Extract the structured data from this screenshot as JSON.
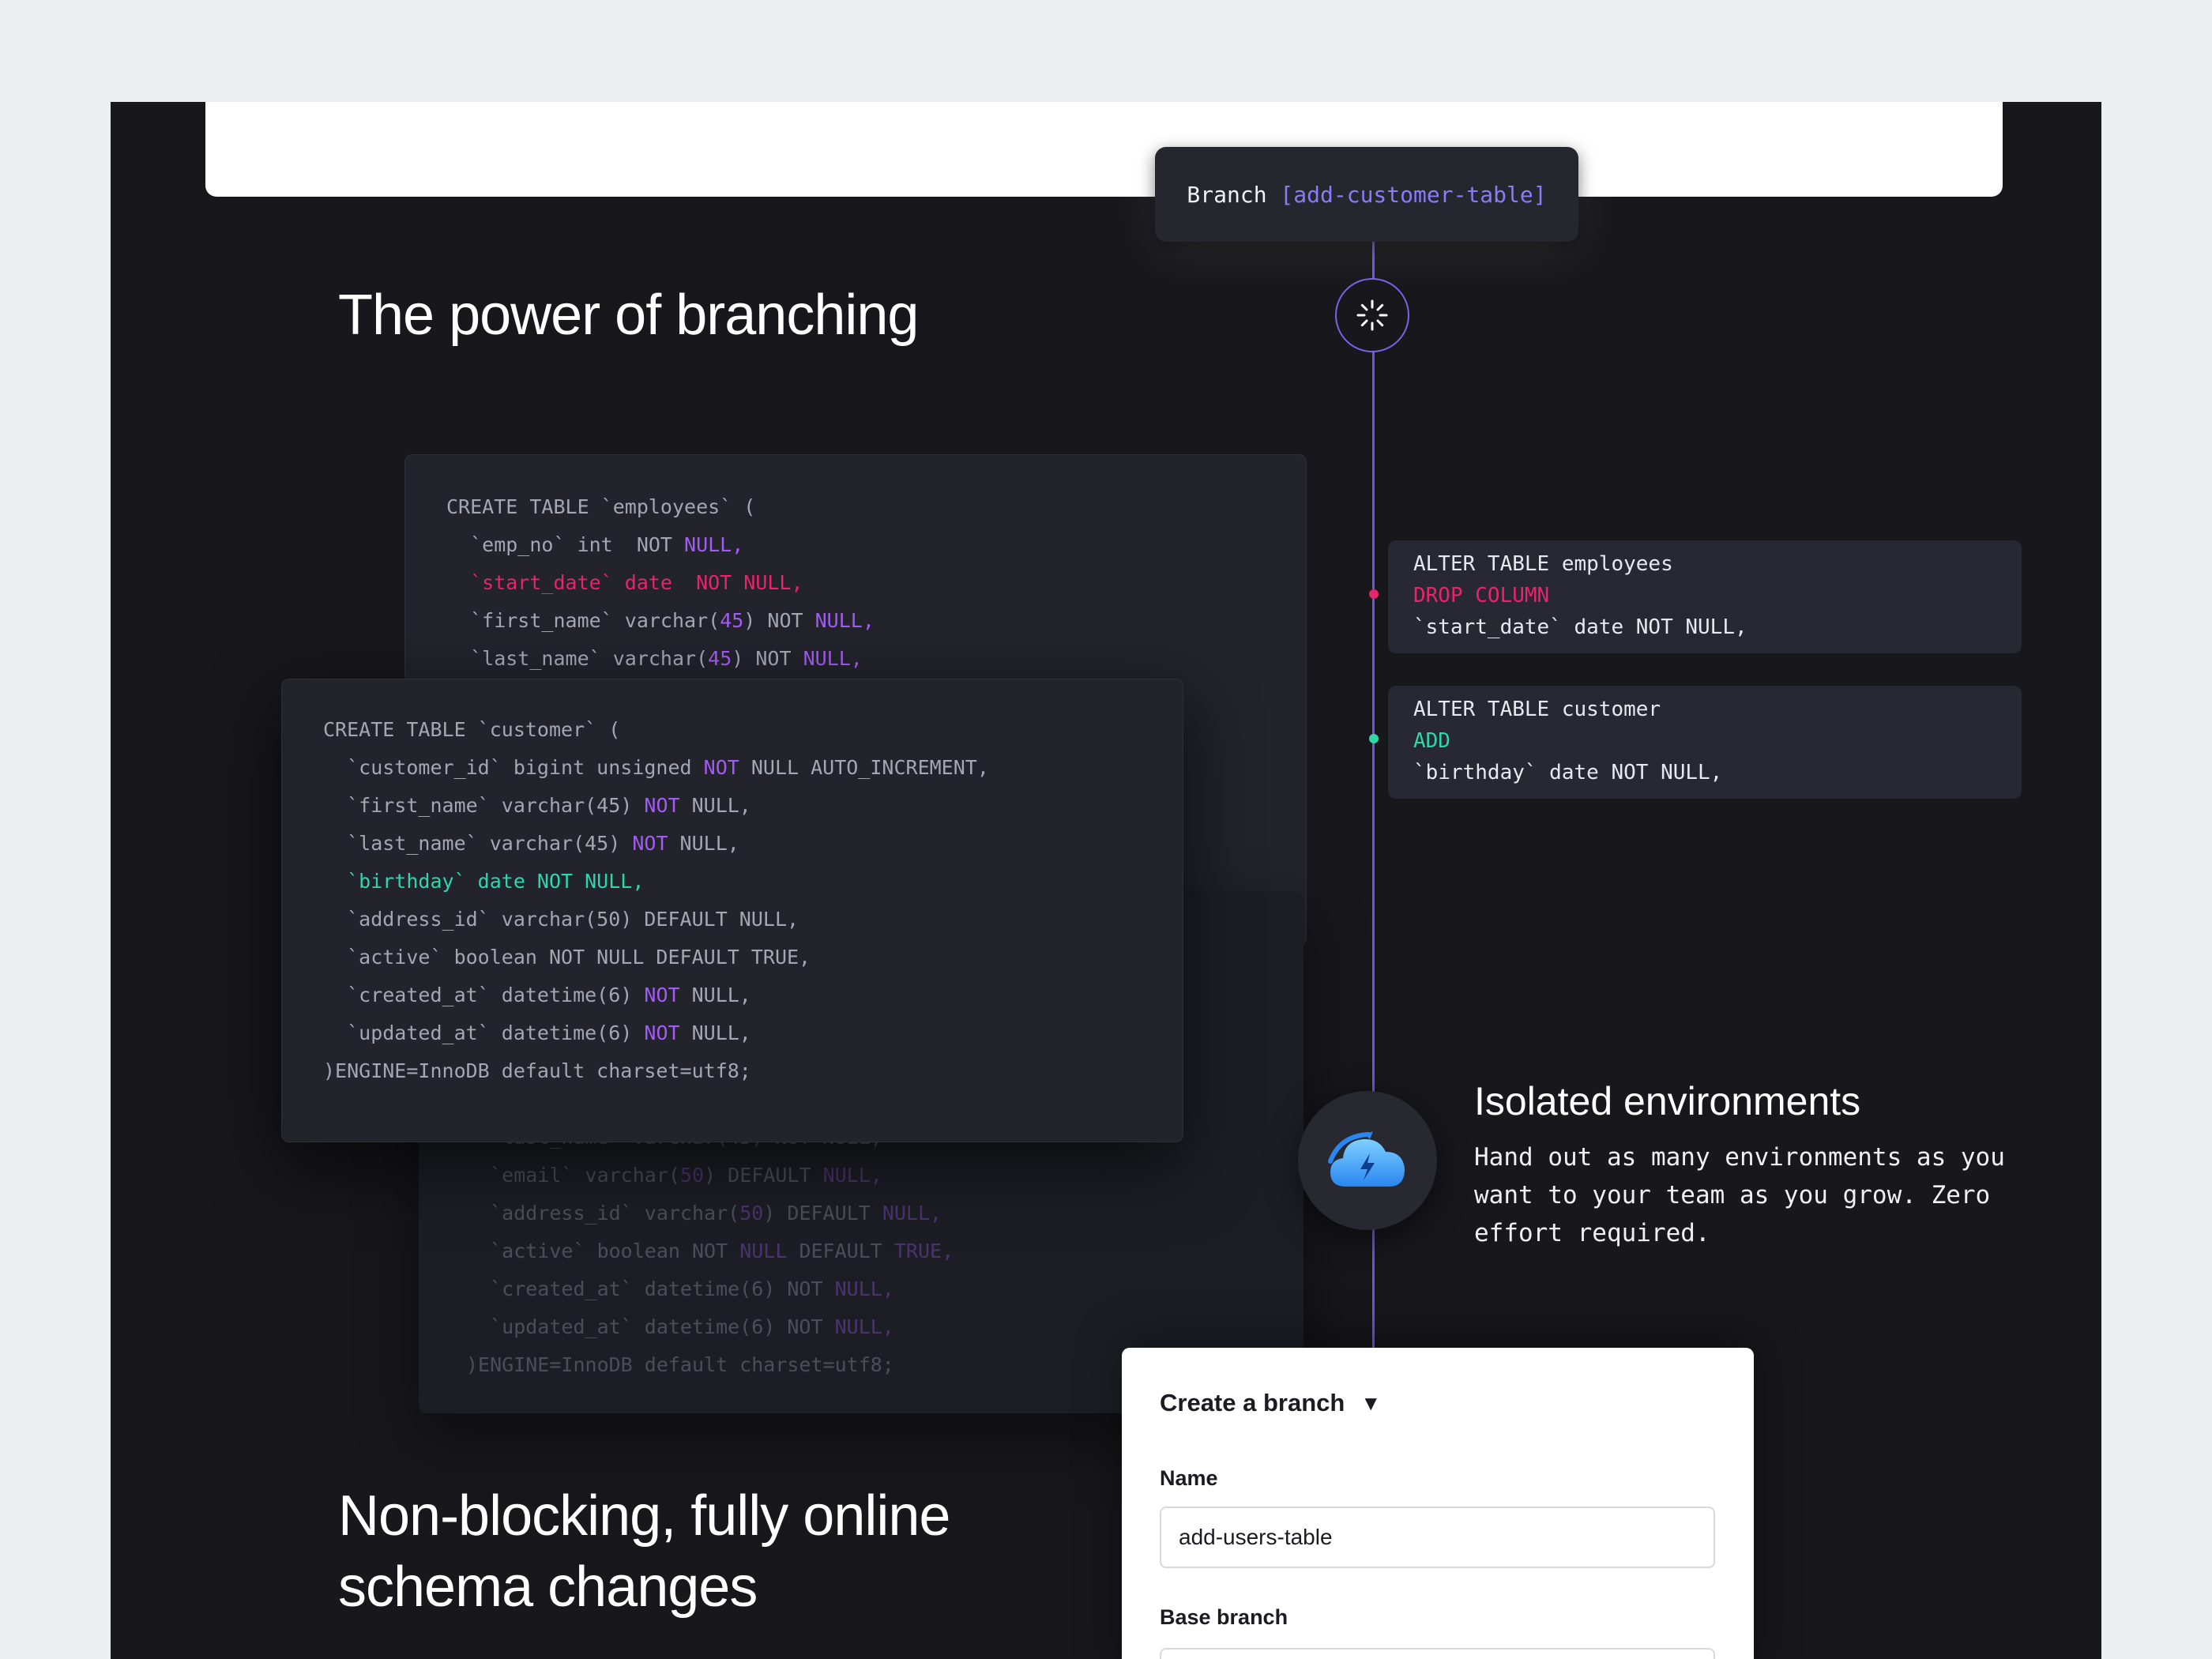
{
  "branch_pill": {
    "prefix": "Branch ",
    "name": "[add-customer-table]"
  },
  "headings": {
    "power": "The power of branching",
    "nonblocking": "Non-blocking, fully online schema changes"
  },
  "employees_code": [
    [
      {
        "t": "CREATE TABLE `employees` ("
      }
    ],
    [
      {
        "t": "  `emp_no` int  NOT "
      },
      {
        "t": "NULL,",
        "c": "kw"
      }
    ],
    [
      {
        "t": "  `start_date` date  NOT NULL,",
        "c": "red"
      }
    ],
    [
      {
        "t": "  `first_name` varchar("
      },
      {
        "t": "45",
        "c": "kw"
      },
      {
        "t": ") NOT "
      },
      {
        "t": "NULL,",
        "c": "kw"
      }
    ],
    [
      {
        "t": "  `last_name` varchar("
      },
      {
        "t": "45",
        "c": "kw"
      },
      {
        "t": ") NOT "
      },
      {
        "t": "NULL,",
        "c": "kw"
      }
    ]
  ],
  "customer_code": [
    [
      {
        "t": "CREATE TABLE `customer` ("
      }
    ],
    [
      {
        "t": "  `customer_id` bigint unsigned "
      },
      {
        "t": "NOT",
        "c": "kw"
      },
      {
        "t": " NULL AUTO_INCREMENT,"
      }
    ],
    [
      {
        "t": "  `first_name` varchar(45) "
      },
      {
        "t": "NOT",
        "c": "kw"
      },
      {
        "t": " NULL,"
      }
    ],
    [
      {
        "t": "  `last_name` varchar(45) "
      },
      {
        "t": "NOT",
        "c": "kw"
      },
      {
        "t": " NULL,"
      }
    ],
    [
      {
        "t": "  `birthday` date NOT NULL,",
        "c": "green"
      }
    ],
    [
      {
        "t": "  `address_id` varchar(50) DEFAULT NULL,"
      }
    ],
    [
      {
        "t": "  `active` boolean NOT NULL DEFAULT TRUE,"
      }
    ],
    [
      {
        "t": "  `created_at` datetime(6) "
      },
      {
        "t": "NOT",
        "c": "kw"
      },
      {
        "t": " NULL,"
      }
    ],
    [
      {
        "t": "  `updated_at` datetime(6) "
      },
      {
        "t": "NOT",
        "c": "kw"
      },
      {
        "t": " NULL,"
      }
    ],
    [
      {
        "t": ")ENGINE=InnoDB default charset=utf8;"
      }
    ]
  ],
  "back_code": [
    [
      {
        "t": "  `last_name` varchar(45) NOT NULL,"
      }
    ],
    [
      {
        "t": "  `email` varchar("
      },
      {
        "t": "50",
        "c": "kw"
      },
      {
        "t": ") DEFAULT "
      },
      {
        "t": "NULL,",
        "c": "kw"
      }
    ],
    [
      {
        "t": "  `address_id` varchar("
      },
      {
        "t": "50",
        "c": "kw"
      },
      {
        "t": ") DEFAULT "
      },
      {
        "t": "NULL,",
        "c": "kw"
      }
    ],
    [
      {
        "t": "  `active` boolean NOT "
      },
      {
        "t": "NULL",
        "c": "kw"
      },
      {
        "t": " DEFAULT "
      },
      {
        "t": "TRUE,",
        "c": "kw"
      }
    ],
    [
      {
        "t": "  `created_at` datetime(6) NOT "
      },
      {
        "t": "NULL,",
        "c": "kw"
      }
    ],
    [
      {
        "t": "  `updated_at` datetime(6) NOT "
      },
      {
        "t": "NULL,",
        "c": "kw"
      }
    ],
    [
      {
        "t": ")ENGINE=InnoDB default charset=utf8;"
      }
    ]
  ],
  "alter_1": [
    [
      {
        "t": "ALTER TABLE employees"
      }
    ],
    [
      {
        "t": "DROP COLUMN",
        "c": "red"
      }
    ],
    [
      {
        "t": "`start_date` date NOT NULL,"
      }
    ]
  ],
  "alter_2": [
    [
      {
        "t": "ALTER TABLE customer"
      }
    ],
    [
      {
        "t": "ADD",
        "c": "green"
      }
    ],
    [
      {
        "t": "`birthday` date NOT NULL,"
      }
    ]
  ],
  "isolated": {
    "title": "Isolated environments",
    "description": "Hand out as many environments as you want to your team as you grow. Zero effort required."
  },
  "form": {
    "title": "Create a branch",
    "name_label": "Name",
    "name_value": "add-users-table",
    "base_label": "Base branch"
  },
  "colors": {
    "accent_purple": "#8b7cf6",
    "drop_red": "#e8246a",
    "add_green": "#2fd7a8",
    "background": "#17171c"
  },
  "icons": {
    "spinner": "loading-spinner-icon",
    "cloud": "cloud-bolt-icon",
    "caret": "caret-down-icon"
  }
}
